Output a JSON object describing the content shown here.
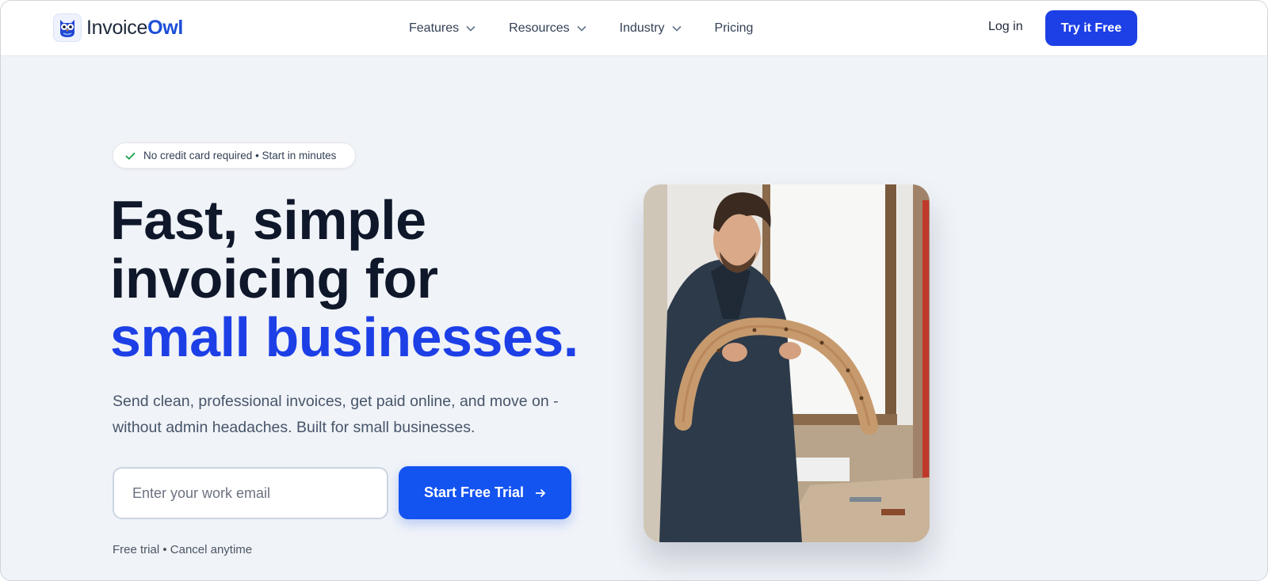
{
  "brand": {
    "name_part1": "Invoice",
    "name_part2": "Owl",
    "icon": "owl-logo-icon",
    "accent_color": "#1d3fe6"
  },
  "nav": {
    "items": [
      {
        "label": "Features",
        "has_dropdown": true
      },
      {
        "label": "Resources",
        "has_dropdown": true
      },
      {
        "label": "Industry",
        "has_dropdown": true
      },
      {
        "label": "Pricing",
        "has_dropdown": false
      }
    ],
    "login_label": "Log in",
    "cta_label": "Try it Free"
  },
  "hero": {
    "badge_text": "No credit card required • Start in minutes",
    "headline_line1": "Fast, simple",
    "headline_line2": "invoicing for",
    "headline_highlight": "small businesses.",
    "subtext": "Send clean, professional invoices, get paid online, and move on - without admin headaches. Built for small businesses.",
    "email_placeholder": "Enter your work email",
    "email_value": "",
    "cta_label": "Start Free Trial",
    "fine_print": "Free trial • Cancel anytime"
  },
  "colors": {
    "page_bg": "#f0f3f8",
    "primary_button": "#1353f0",
    "heading": "#0f172a",
    "check": "#16a34a"
  }
}
